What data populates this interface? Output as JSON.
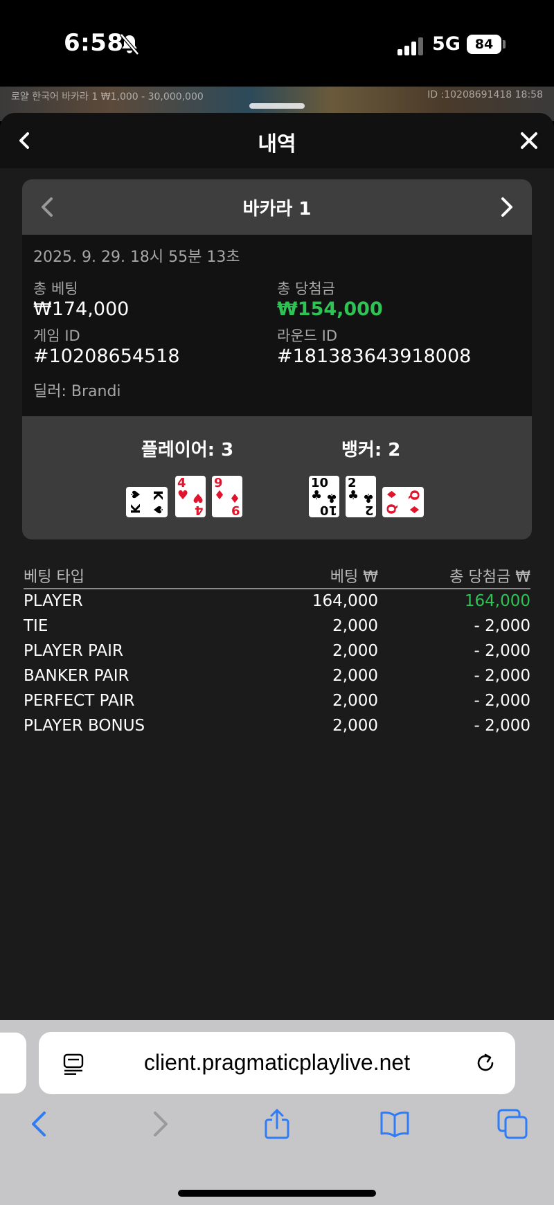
{
  "status_bar": {
    "time": "6:58",
    "network": "5G",
    "battery": "84"
  },
  "background_game": {
    "info": "로얄 한국어 바카라 1 ₩1,000 - 30,000,000",
    "id_time": "ID :10208691418 18:58"
  },
  "sheet": {
    "title": "내역"
  },
  "round": {
    "game_name": "바카라 1",
    "datetime": "2025. 9. 29. 18시 55분 13초",
    "total_bet_label": "총 베팅",
    "total_bet_value": "₩174,000",
    "total_win_label": "총 당첨금",
    "total_win_value": "₩154,000",
    "game_id_label": "게임 ID",
    "game_id_value": "#10208654518",
    "round_id_label": "라운드 ID",
    "round_id_value": "#181383643918008",
    "dealer": "딜러: Brandi"
  },
  "hands": {
    "player_label": "플레이어: 3",
    "banker_label": "뱅커: 2",
    "player_cards": [
      {
        "rank": "K",
        "suit": "♠",
        "color": "black",
        "orientation": "sideways"
      },
      {
        "rank": "4",
        "suit": "♥",
        "color": "red",
        "orientation": "upright"
      },
      {
        "rank": "9",
        "suit": "♦",
        "color": "red",
        "orientation": "upright"
      }
    ],
    "banker_cards": [
      {
        "rank": "10",
        "suit": "♣",
        "color": "black",
        "orientation": "upright"
      },
      {
        "rank": "2",
        "suit": "♣",
        "color": "black",
        "orientation": "upright"
      },
      {
        "rank": "Q",
        "suit": "♦",
        "color": "red",
        "orientation": "sideways"
      }
    ]
  },
  "bets": {
    "headers": {
      "type": "베팅 타입",
      "bet": "베팅 ₩",
      "win": "총 당첨금 ₩"
    },
    "rows": [
      {
        "type": "PLAYER",
        "bet": "164,000",
        "win": "164,000",
        "is_win": true
      },
      {
        "type": "TIE",
        "bet": "2,000",
        "win": "- 2,000",
        "is_win": false
      },
      {
        "type": "PLAYER PAIR",
        "bet": "2,000",
        "win": "- 2,000",
        "is_win": false
      },
      {
        "type": "BANKER PAIR",
        "bet": "2,000",
        "win": "- 2,000",
        "is_win": false
      },
      {
        "type": "PERFECT PAIR",
        "bet": "2,000",
        "win": "- 2,000",
        "is_win": false
      },
      {
        "type": "PLAYER BONUS",
        "bet": "2,000",
        "win": "- 2,000",
        "is_win": false
      }
    ]
  },
  "browser": {
    "url": "client.pragmaticplaylive.net"
  },
  "colors": {
    "win_green": "#2fc254",
    "sheet_bg": "#1b1b1b",
    "accent_blue": "#2f7cf6",
    "card_red": "#e0142d"
  }
}
